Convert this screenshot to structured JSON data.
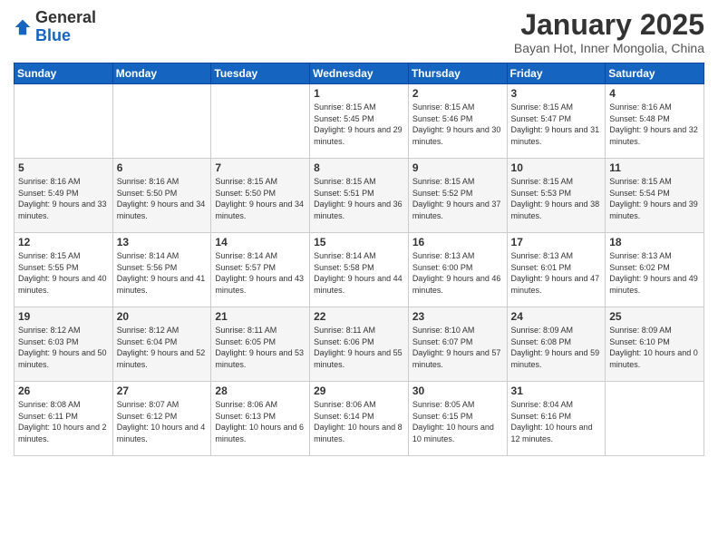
{
  "logo": {
    "general": "General",
    "blue": "Blue"
  },
  "header": {
    "month": "January 2025",
    "location": "Bayan Hot, Inner Mongolia, China"
  },
  "weekdays": [
    "Sunday",
    "Monday",
    "Tuesday",
    "Wednesday",
    "Thursday",
    "Friday",
    "Saturday"
  ],
  "weeks": [
    [
      {
        "day": "",
        "info": ""
      },
      {
        "day": "",
        "info": ""
      },
      {
        "day": "",
        "info": ""
      },
      {
        "day": "1",
        "info": "Sunrise: 8:15 AM\nSunset: 5:45 PM\nDaylight: 9 hours and 29 minutes."
      },
      {
        "day": "2",
        "info": "Sunrise: 8:15 AM\nSunset: 5:46 PM\nDaylight: 9 hours and 30 minutes."
      },
      {
        "day": "3",
        "info": "Sunrise: 8:15 AM\nSunset: 5:47 PM\nDaylight: 9 hours and 31 minutes."
      },
      {
        "day": "4",
        "info": "Sunrise: 8:16 AM\nSunset: 5:48 PM\nDaylight: 9 hours and 32 minutes."
      }
    ],
    [
      {
        "day": "5",
        "info": "Sunrise: 8:16 AM\nSunset: 5:49 PM\nDaylight: 9 hours and 33 minutes."
      },
      {
        "day": "6",
        "info": "Sunrise: 8:16 AM\nSunset: 5:50 PM\nDaylight: 9 hours and 34 minutes."
      },
      {
        "day": "7",
        "info": "Sunrise: 8:15 AM\nSunset: 5:50 PM\nDaylight: 9 hours and 34 minutes."
      },
      {
        "day": "8",
        "info": "Sunrise: 8:15 AM\nSunset: 5:51 PM\nDaylight: 9 hours and 36 minutes."
      },
      {
        "day": "9",
        "info": "Sunrise: 8:15 AM\nSunset: 5:52 PM\nDaylight: 9 hours and 37 minutes."
      },
      {
        "day": "10",
        "info": "Sunrise: 8:15 AM\nSunset: 5:53 PM\nDaylight: 9 hours and 38 minutes."
      },
      {
        "day": "11",
        "info": "Sunrise: 8:15 AM\nSunset: 5:54 PM\nDaylight: 9 hours and 39 minutes."
      }
    ],
    [
      {
        "day": "12",
        "info": "Sunrise: 8:15 AM\nSunset: 5:55 PM\nDaylight: 9 hours and 40 minutes."
      },
      {
        "day": "13",
        "info": "Sunrise: 8:14 AM\nSunset: 5:56 PM\nDaylight: 9 hours and 41 minutes."
      },
      {
        "day": "14",
        "info": "Sunrise: 8:14 AM\nSunset: 5:57 PM\nDaylight: 9 hours and 43 minutes."
      },
      {
        "day": "15",
        "info": "Sunrise: 8:14 AM\nSunset: 5:58 PM\nDaylight: 9 hours and 44 minutes."
      },
      {
        "day": "16",
        "info": "Sunrise: 8:13 AM\nSunset: 6:00 PM\nDaylight: 9 hours and 46 minutes."
      },
      {
        "day": "17",
        "info": "Sunrise: 8:13 AM\nSunset: 6:01 PM\nDaylight: 9 hours and 47 minutes."
      },
      {
        "day": "18",
        "info": "Sunrise: 8:13 AM\nSunset: 6:02 PM\nDaylight: 9 hours and 49 minutes."
      }
    ],
    [
      {
        "day": "19",
        "info": "Sunrise: 8:12 AM\nSunset: 6:03 PM\nDaylight: 9 hours and 50 minutes."
      },
      {
        "day": "20",
        "info": "Sunrise: 8:12 AM\nSunset: 6:04 PM\nDaylight: 9 hours and 52 minutes."
      },
      {
        "day": "21",
        "info": "Sunrise: 8:11 AM\nSunset: 6:05 PM\nDaylight: 9 hours and 53 minutes."
      },
      {
        "day": "22",
        "info": "Sunrise: 8:11 AM\nSunset: 6:06 PM\nDaylight: 9 hours and 55 minutes."
      },
      {
        "day": "23",
        "info": "Sunrise: 8:10 AM\nSunset: 6:07 PM\nDaylight: 9 hours and 57 minutes."
      },
      {
        "day": "24",
        "info": "Sunrise: 8:09 AM\nSunset: 6:08 PM\nDaylight: 9 hours and 59 minutes."
      },
      {
        "day": "25",
        "info": "Sunrise: 8:09 AM\nSunset: 6:10 PM\nDaylight: 10 hours and 0 minutes."
      }
    ],
    [
      {
        "day": "26",
        "info": "Sunrise: 8:08 AM\nSunset: 6:11 PM\nDaylight: 10 hours and 2 minutes."
      },
      {
        "day": "27",
        "info": "Sunrise: 8:07 AM\nSunset: 6:12 PM\nDaylight: 10 hours and 4 minutes."
      },
      {
        "day": "28",
        "info": "Sunrise: 8:06 AM\nSunset: 6:13 PM\nDaylight: 10 hours and 6 minutes."
      },
      {
        "day": "29",
        "info": "Sunrise: 8:06 AM\nSunset: 6:14 PM\nDaylight: 10 hours and 8 minutes."
      },
      {
        "day": "30",
        "info": "Sunrise: 8:05 AM\nSunset: 6:15 PM\nDaylight: 10 hours and 10 minutes."
      },
      {
        "day": "31",
        "info": "Sunrise: 8:04 AM\nSunset: 6:16 PM\nDaylight: 10 hours and 12 minutes."
      },
      {
        "day": "",
        "info": ""
      }
    ]
  ]
}
